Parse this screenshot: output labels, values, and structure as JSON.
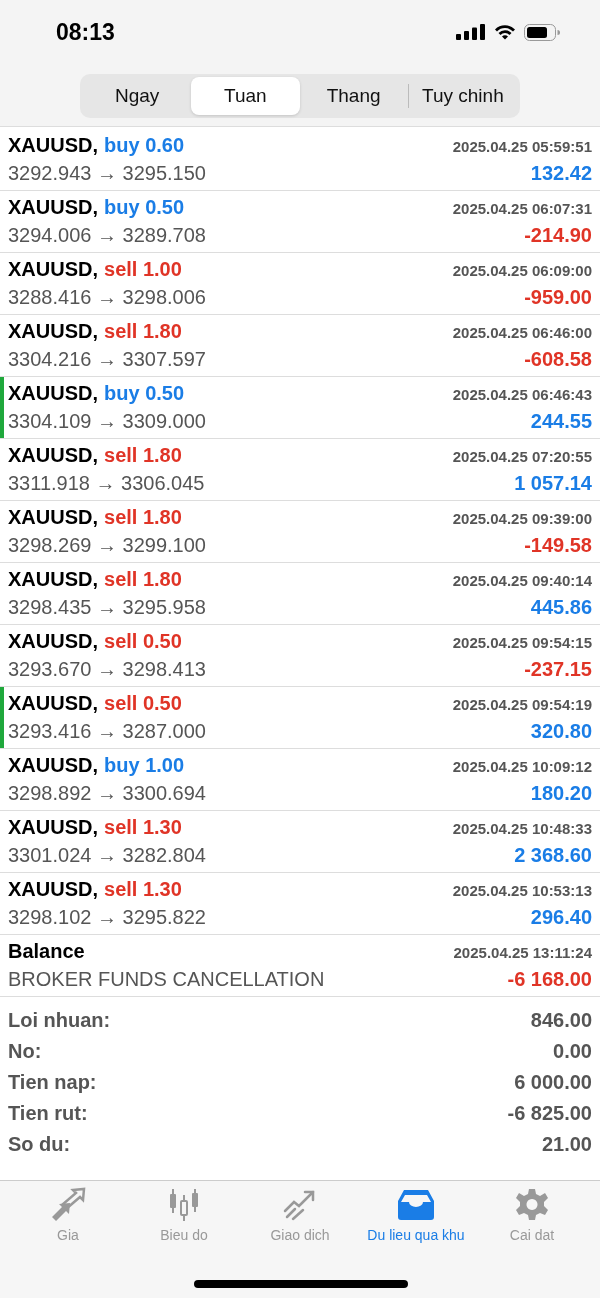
{
  "status_bar": {
    "time": "08:13"
  },
  "segments": [
    {
      "label": "Ngay",
      "selected": false
    },
    {
      "label": "Tuan",
      "selected": true
    },
    {
      "label": "Thang",
      "selected": false
    },
    {
      "label": "Tuy chinh",
      "selected": false
    }
  ],
  "deals": [
    {
      "kind": "trade",
      "symbol": "XAUUSD,",
      "side": {
        "text": "buy 0.60",
        "kind": "buy"
      },
      "time": "2025.04.25 05:59:51",
      "detail": "3292.943 → 3295.150",
      "profit": {
        "text": "132.42",
        "kind": "gain"
      },
      "marked": false
    },
    {
      "kind": "trade",
      "symbol": "XAUUSD,",
      "side": {
        "text": "buy 0.50",
        "kind": "buy"
      },
      "time": "2025.04.25 06:07:31",
      "detail": "3294.006 → 3289.708",
      "profit": {
        "text": "-214.90",
        "kind": "loss"
      },
      "marked": false
    },
    {
      "kind": "trade",
      "symbol": "XAUUSD,",
      "side": {
        "text": "sell 1.00",
        "kind": "sell"
      },
      "time": "2025.04.25 06:09:00",
      "detail": "3288.416 → 3298.006",
      "profit": {
        "text": "-959.00",
        "kind": "loss"
      },
      "marked": false
    },
    {
      "kind": "trade",
      "symbol": "XAUUSD,",
      "side": {
        "text": "sell 1.80",
        "kind": "sell"
      },
      "time": "2025.04.25 06:46:00",
      "detail": "3304.216 → 3307.597",
      "profit": {
        "text": "-608.58",
        "kind": "loss"
      },
      "marked": false
    },
    {
      "kind": "trade",
      "symbol": "XAUUSD,",
      "side": {
        "text": "buy 0.50",
        "kind": "buy"
      },
      "time": "2025.04.25 06:46:43",
      "detail": "3304.109 → 3309.000",
      "profit": {
        "text": "244.55",
        "kind": "gain"
      },
      "marked": true
    },
    {
      "kind": "trade",
      "symbol": "XAUUSD,",
      "side": {
        "text": "sell 1.80",
        "kind": "sell"
      },
      "time": "2025.04.25 07:20:55",
      "detail": "3311.918 → 3306.045",
      "profit": {
        "text": "1 057.14",
        "kind": "gain"
      },
      "marked": false
    },
    {
      "kind": "trade",
      "symbol": "XAUUSD,",
      "side": {
        "text": "sell 1.80",
        "kind": "sell"
      },
      "time": "2025.04.25 09:39:00",
      "detail": "3298.269 → 3299.100",
      "profit": {
        "text": "-149.58",
        "kind": "loss"
      },
      "marked": false
    },
    {
      "kind": "trade",
      "symbol": "XAUUSD,",
      "side": {
        "text": "sell 1.80",
        "kind": "sell"
      },
      "time": "2025.04.25 09:40:14",
      "detail": "3298.435 → 3295.958",
      "profit": {
        "text": "445.86",
        "kind": "gain"
      },
      "marked": false
    },
    {
      "kind": "trade",
      "symbol": "XAUUSD,",
      "side": {
        "text": "sell 0.50",
        "kind": "sell"
      },
      "time": "2025.04.25 09:54:15",
      "detail": "3293.670 → 3298.413",
      "profit": {
        "text": "-237.15",
        "kind": "loss"
      },
      "marked": false
    },
    {
      "kind": "trade",
      "symbol": "XAUUSD,",
      "side": {
        "text": "sell 0.50",
        "kind": "sell"
      },
      "time": "2025.04.25 09:54:19",
      "detail": "3293.416 → 3287.000",
      "profit": {
        "text": "320.80",
        "kind": "gain"
      },
      "marked": true
    },
    {
      "kind": "trade",
      "symbol": "XAUUSD,",
      "side": {
        "text": "buy 1.00",
        "kind": "buy"
      },
      "time": "2025.04.25 10:09:12",
      "detail": "3298.892 → 3300.694",
      "profit": {
        "text": "180.20",
        "kind": "gain"
      },
      "marked": false
    },
    {
      "kind": "trade",
      "symbol": "XAUUSD,",
      "side": {
        "text": "sell 1.30",
        "kind": "sell"
      },
      "time": "2025.04.25 10:48:33",
      "detail": "3301.024 → 3282.804",
      "profit": {
        "text": "2 368.60",
        "kind": "gain"
      },
      "marked": false
    },
    {
      "kind": "trade",
      "symbol": "XAUUSD,",
      "side": {
        "text": "sell 1.30",
        "kind": "sell"
      },
      "time": "2025.04.25 10:53:13",
      "detail": "3298.102 → 3295.822",
      "profit": {
        "text": "296.40",
        "kind": "gain"
      },
      "marked": false
    },
    {
      "kind": "balance",
      "symbol": "Balance",
      "time": "2025.04.25 13:11:24",
      "detail": "BROKER FUNDS CANCELLATION",
      "profit": {
        "text": "-6 168.00",
        "kind": "loss"
      },
      "marked": false
    }
  ],
  "summary": [
    {
      "label": "Loi nhuan:",
      "value": "846.00"
    },
    {
      "label": "No:",
      "value": "0.00"
    },
    {
      "label": "Tien nap:",
      "value": "6 000.00"
    },
    {
      "label": "Tien rut:",
      "value": "-6 825.00"
    },
    {
      "label": "So du:",
      "value": "21.00"
    }
  ],
  "tab_bar": [
    {
      "kind": "price",
      "label": "Gia",
      "selected": false
    },
    {
      "kind": "chart",
      "label": "Bieu do",
      "selected": false
    },
    {
      "kind": "trade",
      "label": "Giao dich",
      "selected": false
    },
    {
      "kind": "history",
      "label": "Du lieu qua khu",
      "selected": true
    },
    {
      "kind": "settings",
      "label": "Cai dat",
      "selected": false
    }
  ]
}
